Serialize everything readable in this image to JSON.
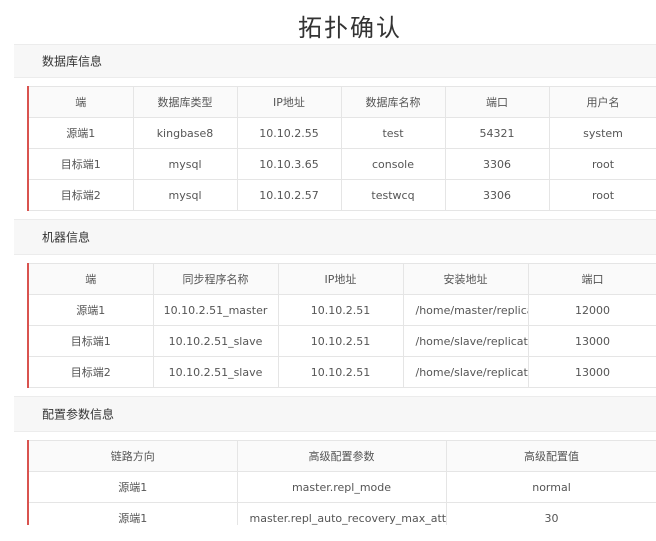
{
  "page_title": "拓扑确认",
  "sections": {
    "db": {
      "title": "数据库信息",
      "columns": [
        "端",
        "数据库类型",
        "IP地址",
        "数据库名称",
        "端口",
        "用户名"
      ],
      "rows": [
        [
          "源端1",
          "kingbase8",
          "10.10.2.55",
          "test",
          "54321",
          "system"
        ],
        [
          "目标端1",
          "mysql",
          "10.10.3.65",
          "console",
          "3306",
          "root"
        ],
        [
          "目标端2",
          "mysql",
          "10.10.2.57",
          "testwcq",
          "3306",
          "root"
        ]
      ]
    },
    "machine": {
      "title": "机器信息",
      "columns": [
        "端",
        "同步程序名称",
        "IP地址",
        "安装地址",
        "端口"
      ],
      "rows": [
        [
          "源端1",
          "10.10.2.51_master",
          "10.10.2.51",
          "/home/master/replicator",
          "12000"
        ],
        [
          "目标端1",
          "10.10.2.51_slave",
          "10.10.2.51",
          "/home/slave/replicator",
          "13000"
        ],
        [
          "目标端2",
          "10.10.2.51_slave",
          "10.10.2.51",
          "/home/slave/replicator",
          "13000"
        ]
      ]
    },
    "config": {
      "title": "配置参数信息",
      "columns": [
        "链路方向",
        "高级配置参数",
        "高级配置值"
      ],
      "rows": [
        [
          "源端1",
          "master.repl_mode",
          "normal"
        ],
        [
          "源端1",
          "master.repl_auto_recovery_max_attempts",
          "30"
        ]
      ]
    }
  }
}
